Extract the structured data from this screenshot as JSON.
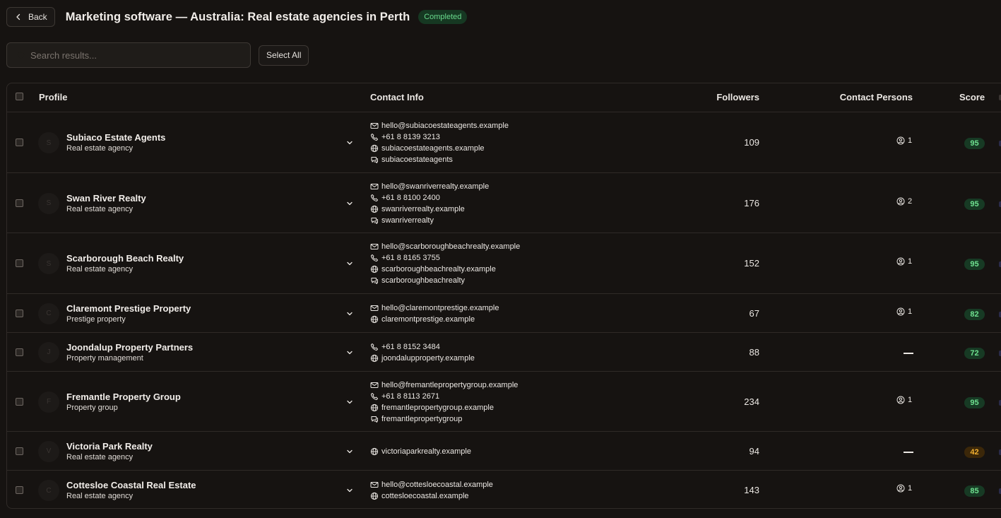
{
  "header": {
    "back_label": "Back",
    "title": "Marketing software — Australia: Real estate agencies in Perth",
    "status": "Completed"
  },
  "search": {
    "placeholder": "Search results...",
    "select_all_label": "Select All"
  },
  "table": {
    "columns": {
      "profile": "Profile",
      "contact": "Contact Info",
      "followers": "Followers",
      "persons": "Contact Persons",
      "score": "Score"
    },
    "rows": [
      {
        "initial": "S",
        "name": "Subiaco Estate Agents",
        "type": "Real estate agency",
        "contacts": [
          {
            "icon": "mail-icon",
            "text": "hello@subiacoestateagents.example"
          },
          {
            "icon": "phone-icon",
            "text": "+61 8 8139 3213"
          },
          {
            "icon": "globe-icon",
            "text": "subiacoestateagents.example"
          },
          {
            "icon": "chat-icon",
            "text": "subiacoestateagents"
          }
        ],
        "followers": "109",
        "persons": "1",
        "score": "95"
      },
      {
        "initial": "S",
        "name": "Swan River Realty",
        "type": "Real estate agency",
        "contacts": [
          {
            "icon": "mail-icon",
            "text": "hello@swanriverrealty.example"
          },
          {
            "icon": "phone-icon",
            "text": "+61 8 8100 2400"
          },
          {
            "icon": "globe-icon",
            "text": "swanriverrealty.example"
          },
          {
            "icon": "chat-icon",
            "text": "swanriverrealty"
          }
        ],
        "followers": "176",
        "persons": "2",
        "score": "95"
      },
      {
        "initial": "S",
        "name": "Scarborough Beach Realty",
        "type": "Real estate agency",
        "contacts": [
          {
            "icon": "mail-icon",
            "text": "hello@scarboroughbeachrealty.example"
          },
          {
            "icon": "phone-icon",
            "text": "+61 8 8165 3755"
          },
          {
            "icon": "globe-icon",
            "text": "scarboroughbeachrealty.example"
          },
          {
            "icon": "chat-icon",
            "text": "scarboroughbeachrealty"
          }
        ],
        "followers": "152",
        "persons": "1",
        "score": "95"
      },
      {
        "initial": "C",
        "name": "Claremont Prestige Property",
        "type": "Prestige property",
        "contacts": [
          {
            "icon": "mail-icon",
            "text": "hello@claremontprestige.example"
          },
          {
            "icon": "globe-icon",
            "text": "claremontprestige.example"
          }
        ],
        "followers": "67",
        "persons": "1",
        "score": "82"
      },
      {
        "initial": "J",
        "name": "Joondalup Property Partners",
        "type": "Property management",
        "contacts": [
          {
            "icon": "phone-icon",
            "text": "+61 8 8152 3484"
          },
          {
            "icon": "globe-icon",
            "text": "joondalupproperty.example"
          }
        ],
        "followers": "88",
        "persons": "",
        "score": "72"
      },
      {
        "initial": "F",
        "name": "Fremantle Property Group",
        "type": "Property group",
        "contacts": [
          {
            "icon": "mail-icon",
            "text": "hello@fremantlepropertygroup.example"
          },
          {
            "icon": "phone-icon",
            "text": "+61 8 8113 2671"
          },
          {
            "icon": "globe-icon",
            "text": "fremantlepropertygroup.example"
          },
          {
            "icon": "chat-icon",
            "text": "fremantlepropertygroup"
          }
        ],
        "followers": "234",
        "persons": "1",
        "score": "95"
      },
      {
        "initial": "V",
        "name": "Victoria Park Realty",
        "type": "Real estate agency",
        "contacts": [
          {
            "icon": "globe-icon",
            "text": "victoriaparkrealty.example"
          }
        ],
        "followers": "94",
        "persons": "",
        "score": "42"
      },
      {
        "initial": "C",
        "name": "Cottesloe Coastal Real Estate",
        "type": "Real estate agency",
        "contacts": [
          {
            "icon": "mail-icon",
            "text": "hello@cottesloecoastal.example"
          },
          {
            "icon": "globe-icon",
            "text": "cottesloecoastal.example"
          }
        ],
        "followers": "143",
        "persons": "1",
        "score": "85"
      }
    ]
  },
  "colors": {
    "background": "#161311",
    "score_high_bg": "#173a24",
    "score_high_fg": "#6ee08f",
    "score_low_bg": "#3b2709",
    "score_low_fg": "#f2b030",
    "status_bg": "#163822",
    "status_fg": "#69d98c"
  }
}
